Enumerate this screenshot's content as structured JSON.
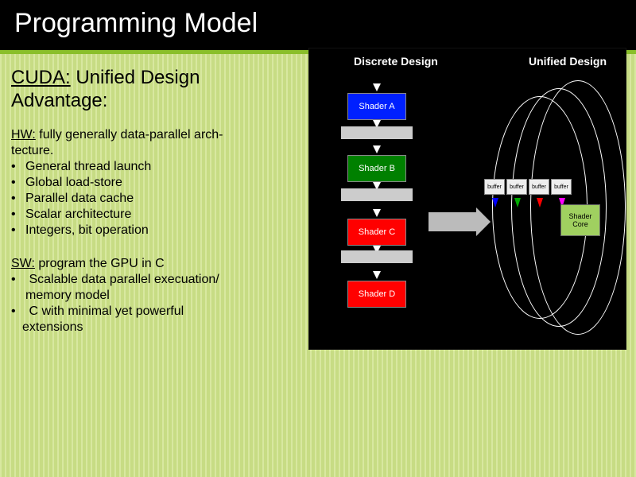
{
  "title": "Programming Model",
  "subtitle_line1": "CUDA:",
  "subtitle_line2": "Unified Design",
  "subtitle_line3": "Advantage:",
  "hw": {
    "label": "HW:",
    "desc_line1": "fully generally data-parallel arch-",
    "desc_line2": "tecture.",
    "bullets": [
      "General thread launch",
      "Global load-store",
      "Parallel data cache",
      "Scalar architecture",
      "Integers, bit operation"
    ]
  },
  "sw": {
    "label": "SW:",
    "desc": "program the GPU in C",
    "bullets_line1": "Scalable data parallel execuation/",
    "bullets_line1b": "memory model",
    "bullets_line2": "C with minimal yet powerful",
    "bullets_line2b": "extensions"
  },
  "diagram": {
    "label_discrete": "Discrete Design",
    "label_unified": "Unified Design",
    "shader_a": "Shader A",
    "shader_b": "Shader B",
    "shader_c": "Shader C",
    "shader_d": "Shader D",
    "buffer": "buffer",
    "shader_core": "Shader Core"
  }
}
